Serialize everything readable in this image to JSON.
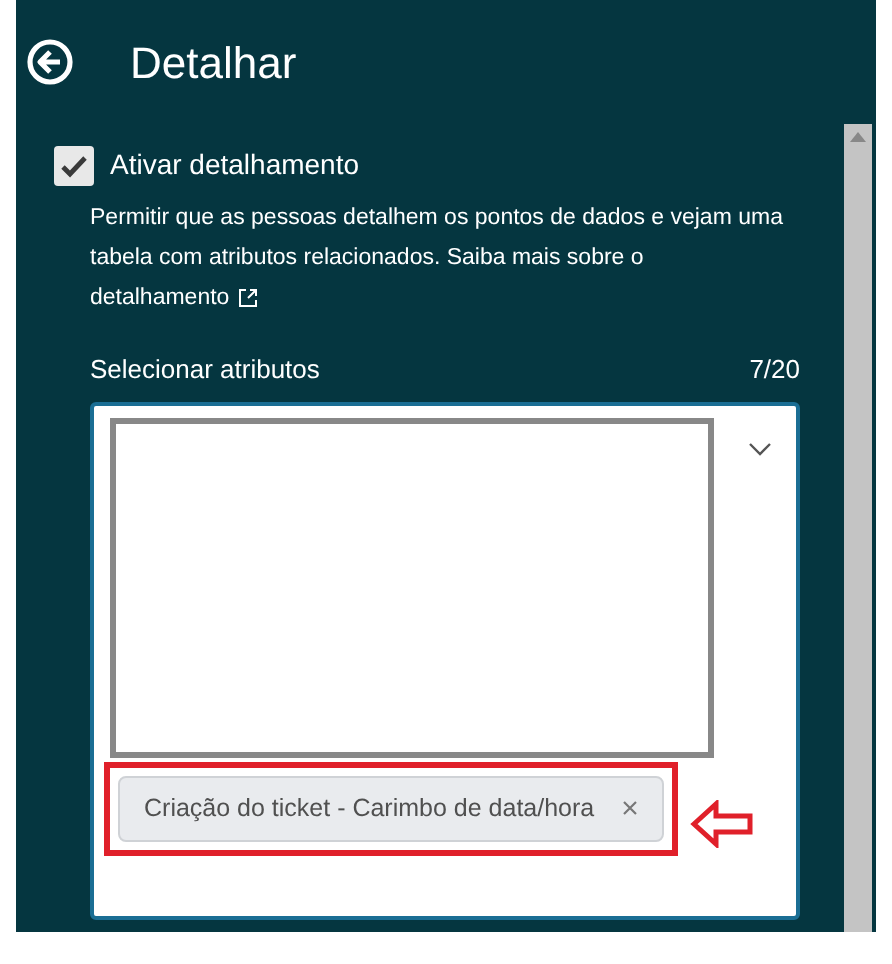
{
  "header": {
    "title": "Detalhar"
  },
  "drillthrough": {
    "label": "Ativar detalhamento",
    "checked": true,
    "description": "Permitir que as pessoas detalhem os pontos de dados e vejam uma tabela com atributos relacionados. Saiba mais sobre o",
    "link": "detalhamento"
  },
  "attributes": {
    "label": "Selecionar atributos",
    "count": "7/20",
    "chips": [
      {
        "label": "Criação do ticket - Carimbo de data/hora",
        "highlighted": true
      }
    ]
  }
}
